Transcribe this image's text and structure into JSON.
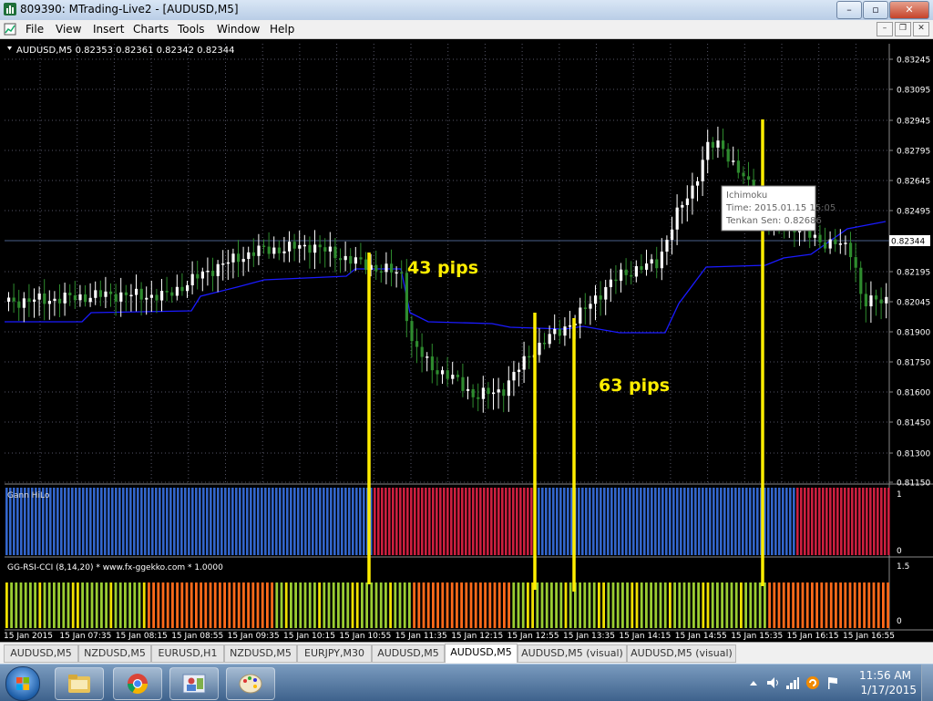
{
  "window": {
    "title": "809390: MTrading-Live2 - [AUDUSD,M5]"
  },
  "menu": [
    "File",
    "View",
    "Insert",
    "Charts",
    "Tools",
    "Window",
    "Help"
  ],
  "chart": {
    "header": "AUDUSD,M5  0.82353 0.82361 0.82342 0.82344",
    "current_price": "0.82344",
    "price_labels": [
      "0.83245",
      "0.83095",
      "0.82945",
      "0.82795",
      "0.82645",
      "0.82495",
      "0.82195",
      "0.82045",
      "0.81900",
      "0.81750",
      "0.81600",
      "0.81450",
      "0.81300",
      "0.81150"
    ],
    "time_labels": [
      "15 Jan 2015",
      "15 Jan 07:35",
      "15 Jan 08:15",
      "15 Jan 08:55",
      "15 Jan 09:35",
      "15 Jan 10:15",
      "15 Jan 10:55",
      "15 Jan 11:35",
      "15 Jan 12:15",
      "15 Jan 12:55",
      "15 Jan 13:35",
      "15 Jan 14:15",
      "15 Jan 14:55",
      "15 Jan 15:35",
      "15 Jan 16:15",
      "15 Jan 16:55"
    ],
    "annotation_1": "43 pips",
    "annotation_2": "63 pips",
    "tooltip": {
      "line1": "Ichimoku",
      "line2": "Time: 2015.01.15 15:05",
      "line3": "Tenkan Sen: 0.82686"
    },
    "indicator_1": {
      "name": "Gann HiLo",
      "max": "1",
      "min": "0",
      "colors": {
        "up": "#3366cc",
        "down": "#cc1f3f"
      }
    },
    "indicator_2": {
      "name": "GG-RSI-CCI (8,14,20)  *  www.fx-ggekko.com  *  1.0000",
      "max": "1.5",
      "min": "0"
    },
    "colors": {
      "up_candle": "#ffffff",
      "down_candle": "#2e8b2e",
      "line": "#1a1aff",
      "annotation": "#ffee00"
    }
  },
  "tabs": [
    "AUDUSD,M5",
    "NZDUSD,M5",
    "EURUSD,H1",
    "NZDUSD,M5",
    "EURJPY,M30",
    "AUDUSD,M5",
    "AUDUSD,M5",
    "AUDUSD,M5 (visual)",
    "AUDUSD,M5 (visual)"
  ],
  "active_tab_index": 6,
  "clock": {
    "time": "11:56 AM",
    "date": "1/17/2015"
  }
}
